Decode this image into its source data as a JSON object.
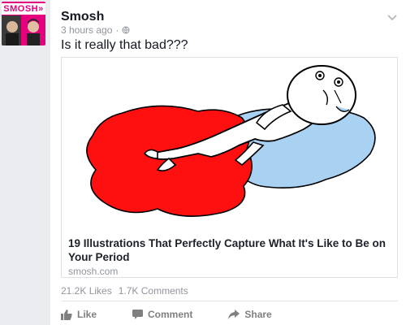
{
  "page": {
    "name": "Smosh",
    "time": "3 hours ago",
    "separator": "·",
    "status": "Is it really that bad???",
    "avatar_logo": "SMOSH»"
  },
  "link": {
    "title": "19 Illustrations That Perfectly Capture What It's Like to Be on Your Period",
    "domain": "smosh.com"
  },
  "stats": {
    "likes": "21.2K Likes",
    "comments": "1.7K Comments"
  },
  "actions": {
    "like": "Like",
    "comment": "Comment",
    "share": "Share"
  },
  "colors": {
    "brand_pink": "#e5007e",
    "blood_red": "#ff1010",
    "water_blue": "#a9d1f2",
    "muted_text": "#90949c"
  },
  "icons": [
    "chevron-down-icon",
    "globe-icon",
    "like-thumb-icon",
    "comment-bubble-icon",
    "share-arrow-icon"
  ]
}
